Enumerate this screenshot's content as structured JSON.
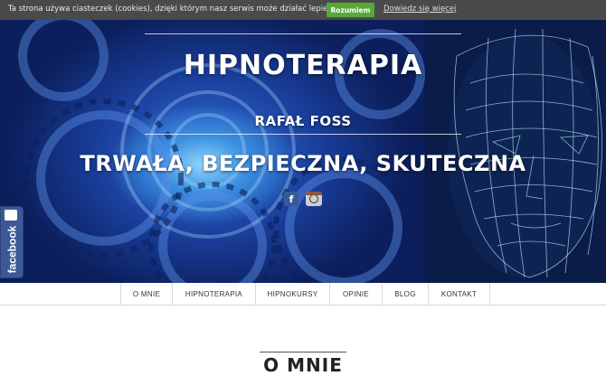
{
  "cookie_bar": {
    "message": "Ta strona używa ciasteczek (cookies), dzięki którym nasz serwis może działać lepiej",
    "accept_label": "Rozumiem",
    "more_link": "Dowiedz się więcej"
  },
  "hero": {
    "title": "HIPNOTERAPIA",
    "subtitle": "RAFAŁ FOSS",
    "tagline": "TRWAŁA, BEZPIECZNA, SKUTECZNA",
    "social": {
      "facebook_glyph": "f",
      "icons": [
        "facebook-icon",
        "instagram-icon"
      ]
    }
  },
  "facebook_tab": {
    "label": "facebook"
  },
  "nav": {
    "items": [
      "O MNIE",
      "HIPNOTERAPIA",
      "HIPNOKURSY",
      "OPINIE",
      "BLOG",
      "KONTAKT"
    ]
  },
  "section": {
    "title": "O MNIE"
  },
  "colors": {
    "cookie_bg": "#4a4a4a",
    "accept_green": "#5aa83a",
    "facebook_blue": "#3b5998",
    "hero_blue": "#1a3f9c"
  }
}
